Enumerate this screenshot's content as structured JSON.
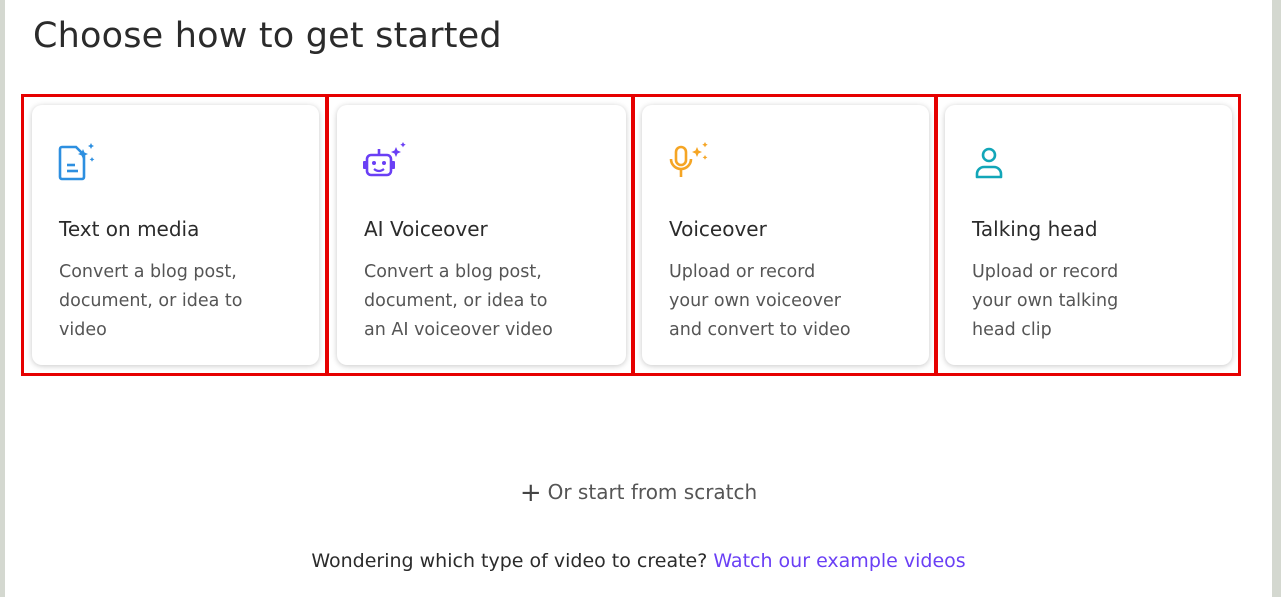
{
  "title": "Choose how to get started",
  "cards": [
    {
      "icon": "document-sparkle-icon",
      "title": "Text on media",
      "desc_lines": [
        "Convert a blog post,",
        "document, or idea to",
        "video"
      ],
      "accent": "#2d8fe0"
    },
    {
      "icon": "robot-sparkle-icon",
      "title": "AI Voiceover",
      "desc_lines": [
        "Convert a blog post,",
        "document, or idea to",
        "an AI voiceover video"
      ],
      "accent": "#6a3ff5"
    },
    {
      "icon": "microphone-sparkle-icon",
      "title": "Voiceover",
      "desc_lines": [
        "Upload or record",
        "your own voiceover",
        "and convert to video"
      ],
      "accent": "#f5a524"
    },
    {
      "icon": "person-icon",
      "title": "Talking head",
      "desc_lines": [
        "Upload or record",
        "your own talking",
        "head clip"
      ],
      "accent": "#12a6b8"
    }
  ],
  "scratch_label": "Or start from scratch",
  "help": {
    "text": "Wondering which type of video to create?",
    "link": "Watch our example videos",
    "link_color": "#6a3ff5"
  }
}
